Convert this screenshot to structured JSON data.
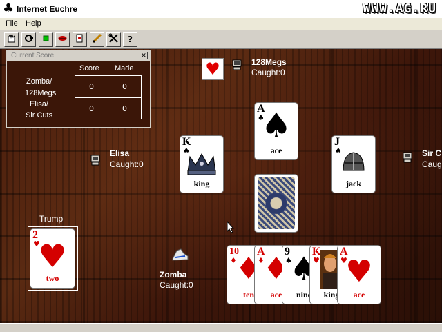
{
  "window": {
    "title": "Internet Euchre",
    "watermark": "WWW.AG.RU"
  },
  "menu": [
    "File",
    "Help"
  ],
  "toolbar": {
    "icons": [
      "new-game-icon",
      "connect-icon",
      "green-light-icon",
      "lips-chat-icon",
      "hand-card-icon",
      "pencil-icon",
      "tools-icon",
      "help-icon"
    ],
    "help_glyph": "?"
  },
  "score_panel": {
    "title": "Current Score",
    "close_glyph": "✕",
    "col_score": "Score",
    "col_made": "Made",
    "team1_line1": "Zomba/",
    "team1_line2": "128Megs",
    "team2_line1": "Elisa/",
    "team2_line2": "Sir Cuts",
    "team1_score": "0",
    "team1_made": "0",
    "team2_score": "0",
    "team2_made": "0"
  },
  "players": {
    "north": {
      "name": "128Megs",
      "caught": "Caught:0"
    },
    "west": {
      "name": "Elisa",
      "caught": "Caught:0"
    },
    "east": {
      "name": "Sir C",
      "caught": "Caug"
    },
    "south": {
      "name": "Zomba",
      "caught": "Caught:0"
    }
  },
  "dealer_suit": "♥",
  "trump": {
    "label": "Trump",
    "card": {
      "rank": "2",
      "suit": "♥",
      "word": "two"
    }
  },
  "played": {
    "north": {
      "rank": "A",
      "suit": "♠",
      "word": "ace"
    },
    "west": {
      "rank": "K",
      "suit": "♠",
      "word": "king"
    },
    "east": {
      "rank": "J",
      "suit": "♠",
      "word": "jack"
    }
  },
  "hand": [
    {
      "rank": "10",
      "suit": "♦",
      "word": "ten"
    },
    {
      "rank": "A",
      "suit": "♦",
      "word": "ace"
    },
    {
      "rank": "9",
      "suit": "♠",
      "word": "nine"
    },
    {
      "rank": "K",
      "suit": "♥",
      "word": "king"
    },
    {
      "rank": "A",
      "suit": "♥",
      "word": "ace"
    }
  ],
  "colors": {
    "felt": "#4a1d0c",
    "red_suit": "#d40000",
    "black_suit": "#000000"
  }
}
